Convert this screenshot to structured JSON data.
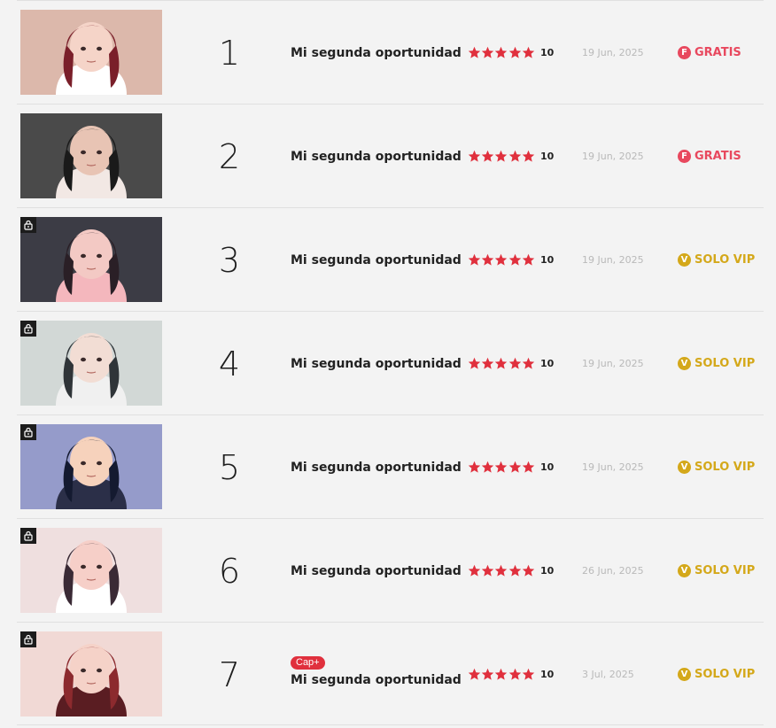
{
  "colors": {
    "star": "#e0303d",
    "free": "#e8485e",
    "vip": "#d4a81a",
    "cap_badge": "#e0303d"
  },
  "episodes": [
    {
      "number": "1",
      "title": "Mi segunda oportunidad",
      "rating": "10",
      "date": "19 Jun, 2025",
      "badge": "GRATIS",
      "badge_letter": "F",
      "badge_type": "free",
      "locked": false,
      "cap": null,
      "thumb": {
        "bg": "#d9b2a4",
        "hair": "#7a1f2a",
        "skin": "#f5d4c8",
        "accent": "#ffffff"
      }
    },
    {
      "number": "2",
      "title": "Mi segunda oportunidad",
      "rating": "10",
      "date": "19 Jun, 2025",
      "badge": "GRATIS",
      "badge_letter": "F",
      "badge_type": "free",
      "locked": false,
      "cap": null,
      "thumb": {
        "bg": "#3b3b3b",
        "hair": "#1a1a1a",
        "skin": "#e8c4b4",
        "accent": "#f2e8e4"
      }
    },
    {
      "number": "3",
      "title": "Mi segunda oportunidad",
      "rating": "10",
      "date": "19 Jun, 2025",
      "badge": "SOLO VIP",
      "badge_letter": "V",
      "badge_type": "vip",
      "locked": true,
      "cap": null,
      "thumb": {
        "bg": "#2c2c36",
        "hair": "#2a1f26",
        "skin": "#f3c9c4",
        "accent": "#f4b7bd"
      }
    },
    {
      "number": "4",
      "title": "Mi segunda oportunidad",
      "rating": "10",
      "date": "19 Jun, 2025",
      "badge": "SOLO VIP",
      "badge_letter": "V",
      "badge_type": "vip",
      "locked": true,
      "cap": null,
      "thumb": {
        "bg": "#cfd5d3",
        "hair": "#2f3438",
        "skin": "#f2ddd4",
        "accent": "#f0f0f0"
      }
    },
    {
      "number": "5",
      "title": "Mi segunda oportunidad",
      "rating": "10",
      "date": "19 Jun, 2025",
      "badge": "SOLO VIP",
      "badge_letter": "V",
      "badge_type": "vip",
      "locked": true,
      "cap": null,
      "thumb": {
        "bg": "#8c93c6",
        "hair": "#141a30",
        "skin": "#f6d2bc",
        "accent": "#2b2f48"
      }
    },
    {
      "number": "6",
      "title": "Mi segunda oportunidad",
      "rating": "10",
      "date": "26 Jun, 2025",
      "badge": "SOLO VIP",
      "badge_letter": "V",
      "badge_type": "vip",
      "locked": true,
      "cap": null,
      "thumb": {
        "bg": "#eedddd",
        "hair": "#3a2a35",
        "skin": "#f6cfc8",
        "accent": "#ffffff"
      }
    },
    {
      "number": "7",
      "title": "Mi segunda oportunidad",
      "rating": "10",
      "date": "3 Jul, 2025",
      "badge": "SOLO VIP",
      "badge_letter": "V",
      "badge_type": "vip",
      "locked": true,
      "cap": "Cap+",
      "thumb": {
        "bg": "#f0d6d2",
        "hair": "#8c2a2e",
        "skin": "#f5d2c8",
        "accent": "#5a1d22"
      }
    }
  ]
}
